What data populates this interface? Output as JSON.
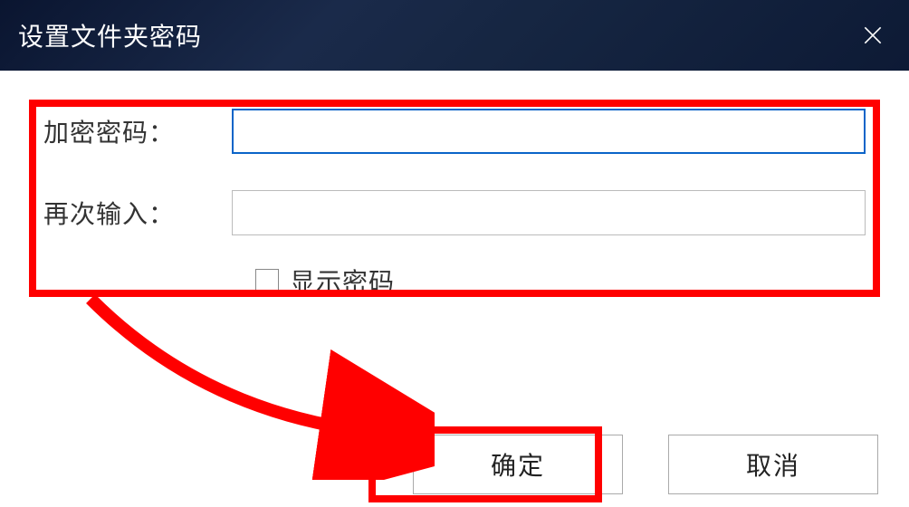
{
  "dialog": {
    "title": "设置文件夹密码",
    "fields": {
      "password_label": "加密密码：",
      "confirm_label": "再次输入：",
      "password_value": "",
      "confirm_value": ""
    },
    "checkbox": {
      "show_password_label": "显示密码",
      "checked": false
    },
    "buttons": {
      "ok_label": "确定",
      "cancel_label": "取消"
    }
  },
  "annotations": {
    "highlight_color": "#ff0000"
  }
}
